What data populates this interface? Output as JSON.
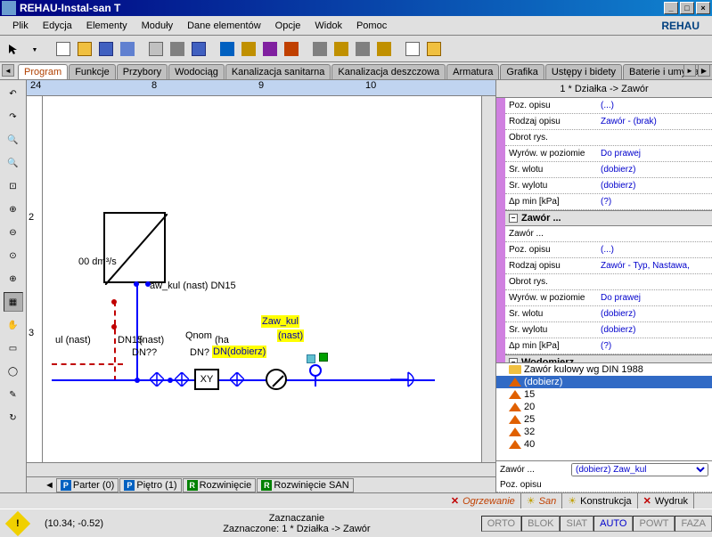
{
  "window": {
    "title": "REHAU-Instal-san T",
    "brand": "REHAU"
  },
  "menu": [
    "Plik",
    "Edycja",
    "Elementy",
    "Moduły",
    "Dane elementów",
    "Opcje",
    "Widok",
    "Pomoc"
  ],
  "tabs": [
    "Program",
    "Funkcje",
    "Przybory",
    "Wodociąg",
    "Kanalizacja sanitarna",
    "Kanalizacja deszczowa",
    "Armatura",
    "Grafika",
    "Ustępy i bidety",
    "Baterie i umywalki"
  ],
  "ruler_top": {
    "mark0": "24",
    "ticks": [
      "8",
      "9",
      "10"
    ]
  },
  "ruler_left": [
    "2",
    "3"
  ],
  "drawing": {
    "flow_label": "00 dm³/s",
    "valve1": "aw_kul (nast) DN15",
    "valve2a": "ul (nast)",
    "valve2b": "DN15",
    "nast": "(nast)",
    "qnom": "Qnom",
    "qnom_ha": "(ha",
    "dn_unk": "DN??",
    "dn_q": "DN?",
    "zaw_kul": "Zaw_kul",
    "nast2": "(nast)",
    "dn_dobierz": "DN(dobierz)",
    "xy": "XY"
  },
  "sheets": [
    {
      "badge": "P",
      "label": "Parter (0)"
    },
    {
      "badge": "P",
      "label": "Piętro (1)"
    },
    {
      "badge": "R",
      "label": "Rozwinięcie"
    },
    {
      "badge": "R",
      "label": "Rozwinięcie SAN"
    }
  ],
  "panel": {
    "header": "1 * Działka -> Zawór",
    "rows1": [
      {
        "k": "Poz. opisu",
        "v": "(...)"
      },
      {
        "k": "Rodzaj opisu",
        "v": "Zawór - (brak)"
      },
      {
        "k": "Obrot rys.",
        "v": ""
      },
      {
        "k": "Wyrów. w poziomie",
        "v": "Do prawej"
      },
      {
        "k": "Śr. wlotu",
        "v": "(dobierz)"
      },
      {
        "k": "Śr. wylotu",
        "v": "(dobierz)"
      },
      {
        "k": "Δp min [kPa]",
        "v": "(?)"
      }
    ],
    "section1": "Zawór ...",
    "rows2": [
      {
        "k": "Zawór ...",
        "v": ""
      },
      {
        "k": "Poz. opisu",
        "v": "(...)"
      },
      {
        "k": "Rodzaj opisu",
        "v": "Zawór - Typ, Nastawa,"
      },
      {
        "k": "Obrot rys.",
        "v": ""
      },
      {
        "k": "Wyrów. w poziomie",
        "v": "Do prawej"
      },
      {
        "k": "Śr. wlotu",
        "v": "(dobierz)"
      },
      {
        "k": "Śr. wylotu",
        "v": "(dobierz)"
      },
      {
        "k": "Δp min [kPa]",
        "v": "(?)"
      }
    ],
    "section2": "Wodomierz ...",
    "tree": {
      "root": "Zawór kulowy wg DIN 1988",
      "items": [
        "(dobierz)",
        "15",
        "20",
        "25",
        "32",
        "40"
      ]
    },
    "combo": {
      "label": "Zawór ...",
      "value": "(dobierz) Zaw_kul"
    },
    "bottom_label": "Poz. opisu"
  },
  "status_tabs": [
    {
      "icon": "x",
      "label": "Ogrzewanie"
    },
    {
      "icon": "sun",
      "label": "San"
    },
    {
      "icon": "sun",
      "label": "Konstrukcja"
    },
    {
      "icon": "x",
      "label": "Wydruk"
    }
  ],
  "status": {
    "coords": "(10.34; -0.52)",
    "center1": "Zaznaczanie",
    "center2": "Zaznaczone: 1 * Działka -> Zawór",
    "modes": [
      "ORTO",
      "BLOK",
      "SIAT",
      "AUTO",
      "POWT",
      "FAZA"
    ]
  }
}
